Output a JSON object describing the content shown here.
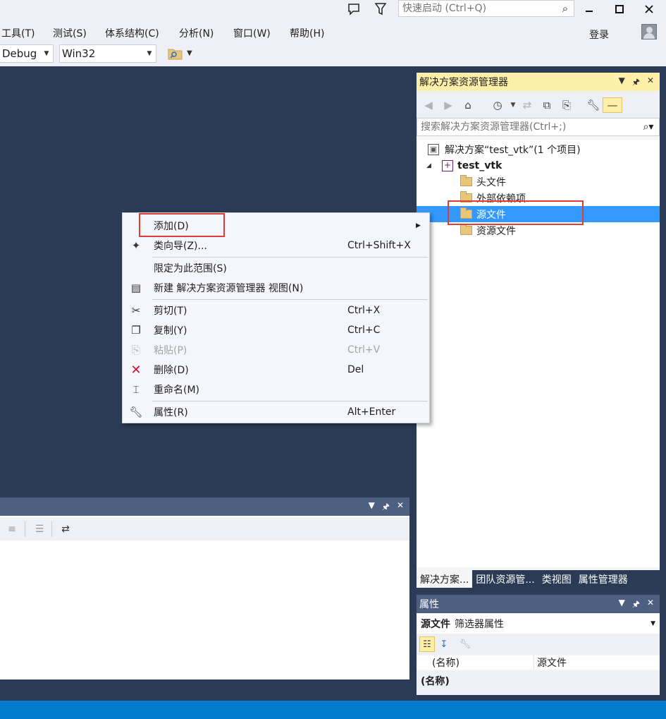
{
  "titlebar": {
    "quick_launch_placeholder": "快速启动 (Ctrl+Q)"
  },
  "menubar": {
    "items": [
      "工具(T)",
      "测试(S)",
      "体系结构(C)",
      "分析(N)",
      "窗口(W)",
      "帮助(H)"
    ],
    "login": "登录"
  },
  "toolbar": {
    "config": "Debug",
    "platform": "Win32"
  },
  "solution_explorer": {
    "title": "解决方案资源管理器",
    "search_placeholder": "搜索解决方案资源管理器(Ctrl+;)",
    "tree": [
      {
        "label": "解决方案“test_vtk”(1 个项目)"
      },
      {
        "label": "test_vtk"
      },
      {
        "label": "头文件"
      },
      {
        "label": "外部依赖项"
      },
      {
        "label": "源文件"
      },
      {
        "label": "资源文件"
      }
    ],
    "tabs": [
      "解决方案...",
      "团队资源管...",
      "类视图",
      "属性管理器"
    ]
  },
  "properties": {
    "title": "属性",
    "object_name": "源文件",
    "object_type": "筛选器属性",
    "grid_name": "(名称)",
    "grid_value": "源文件",
    "desc_title": "(名称)"
  },
  "context_menu": {
    "items": [
      {
        "label": "添加(D)",
        "shortcut": "",
        "icon": "submenu"
      },
      {
        "label": "类向导(Z)...",
        "shortcut": "Ctrl+Shift+X",
        "icon": "class-wizard-icon"
      },
      {
        "label": "限定为此范围(S)",
        "shortcut": "",
        "icon": ""
      },
      {
        "label": "新建 解决方案资源管理器 视图(N)",
        "shortcut": "",
        "icon": "new-view-icon"
      },
      {
        "label": "剪切(T)",
        "shortcut": "Ctrl+X",
        "icon": "cut-icon"
      },
      {
        "label": "复制(Y)",
        "shortcut": "Ctrl+C",
        "icon": "copy-icon"
      },
      {
        "label": "粘贴(P)",
        "shortcut": "Ctrl+V",
        "icon": "paste-icon"
      },
      {
        "label": "删除(D)",
        "shortcut": "Del",
        "icon": "delete-icon"
      },
      {
        "label": "重命名(M)",
        "shortcut": "",
        "icon": "rename-icon"
      },
      {
        "label": "属性(R)",
        "shortcut": "Alt+Enter",
        "icon": "wrench-icon"
      }
    ]
  },
  "colors": {
    "accent": "#007acc",
    "selection": "#3399ff",
    "highlight_box": "#e03c31",
    "active_panel_title": "#fef0a8",
    "background": "#2b3a55"
  }
}
